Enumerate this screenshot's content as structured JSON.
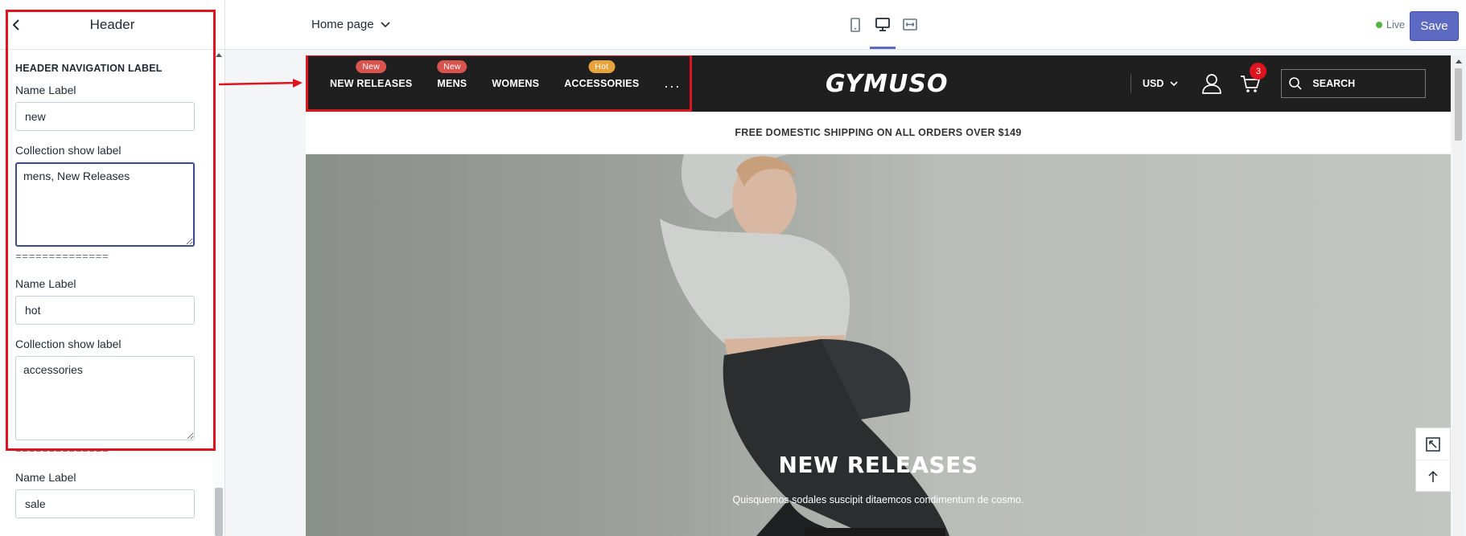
{
  "sidebar": {
    "title": "Header",
    "section_title": "HEADER NAVIGATION LABEL",
    "groups": [
      {
        "name_label": "Name Label",
        "name_value": "new",
        "coll_label": "Collection show label",
        "coll_value": "mens, New Releases"
      },
      {
        "name_label": "Name Label",
        "name_value": "hot",
        "coll_label": "Collection show label",
        "coll_value": "accessories"
      },
      {
        "name_label": "Name Label",
        "name_value": "sale"
      }
    ],
    "divider": "=============="
  },
  "topbar": {
    "page_select": "Home page",
    "live_label": "Live",
    "save_label": "Save"
  },
  "store": {
    "nav": [
      {
        "label": "NEW RELEASES",
        "badge": "New"
      },
      {
        "label": "MENS",
        "badge": "New"
      },
      {
        "label": "WOMENS",
        "badge": ""
      },
      {
        "label": "ACCESSORIES",
        "badge": "Hot"
      }
    ],
    "more": "...",
    "logo": "GYMUSO",
    "currency": "USD",
    "cart_count": "3",
    "search_label": "SEARCH",
    "announcement": "FREE DOMESTIC SHIPPING ON ALL ORDERS OVER $149",
    "hero_title": "NEW RELEASES",
    "hero_subtitle": "Quisquemos sodales suscipit ditaemcos condimentum de cosmo."
  },
  "colors": {
    "accent": "#5c6ac4",
    "highlight": "#e0141e",
    "badge_new": "#d9534f",
    "badge_hot": "#e8a33d",
    "header_bg": "#1f1f1f",
    "live": "#50b83c"
  },
  "icons": [
    "chevron-left-icon",
    "chevron-down-icon",
    "tablet-icon",
    "desktop-icon",
    "fullwidth-icon",
    "user-icon",
    "cart-icon",
    "search-icon",
    "resize-icon",
    "arrow-up-icon"
  ]
}
